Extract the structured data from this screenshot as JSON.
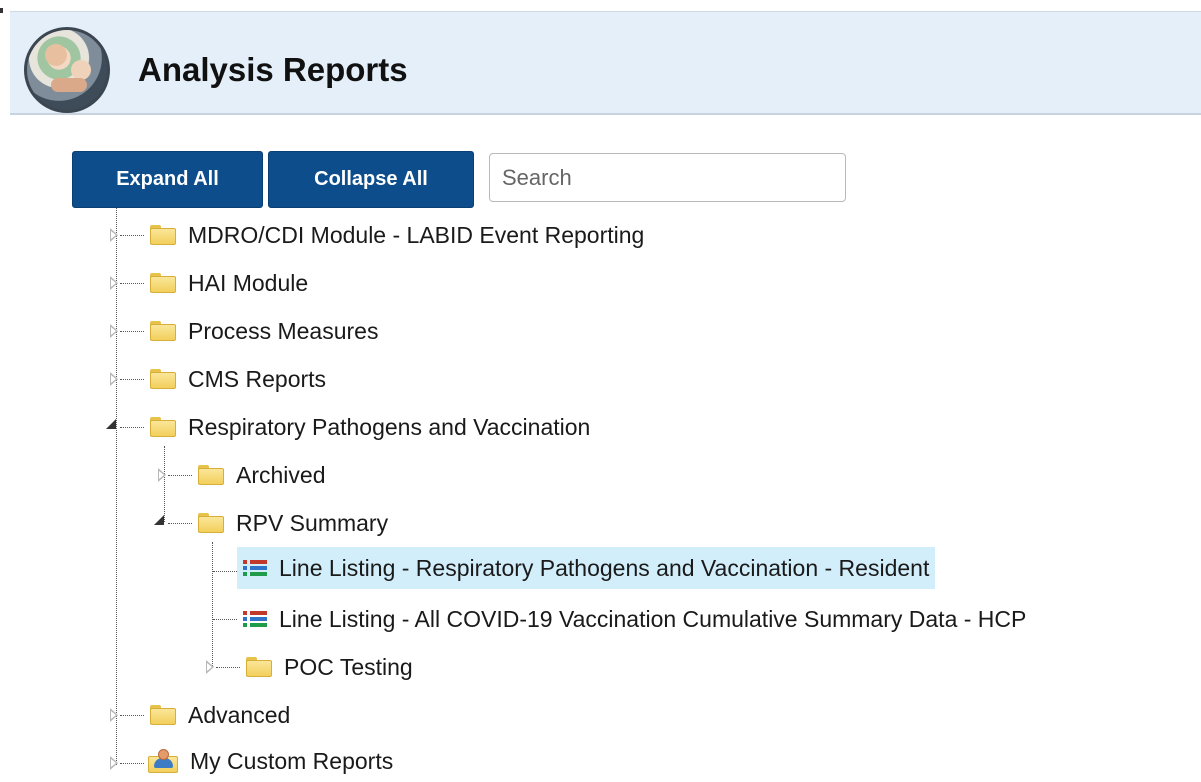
{
  "header": {
    "title": "Analysis Reports",
    "logo_icon": "caregiver-photo-logo"
  },
  "toolbar": {
    "expand_all_label": "Expand All",
    "collapse_all_label": "Collapse All",
    "search_placeholder": "Search"
  },
  "tree": {
    "items": [
      {
        "label": "MDRO/CDI Module - LABID Event Reporting",
        "icon": "folder-icon",
        "state": "collapsed"
      },
      {
        "label": "HAI Module",
        "icon": "folder-icon",
        "state": "collapsed"
      },
      {
        "label": "Process Measures",
        "icon": "folder-icon",
        "state": "collapsed"
      },
      {
        "label": "CMS Reports",
        "icon": "folder-icon",
        "state": "collapsed"
      },
      {
        "label": "Respiratory Pathogens and Vaccination",
        "icon": "folder-icon",
        "state": "expanded",
        "children": [
          {
            "label": "Archived",
            "icon": "folder-icon",
            "state": "collapsed"
          },
          {
            "label": "RPV Summary",
            "icon": "folder-icon",
            "state": "expanded",
            "children": [
              {
                "label": "Line Listing - Respiratory Pathogens and Vaccination - Resident",
                "icon": "list-report-icon",
                "selected": true
              },
              {
                "label": "Line Listing - All COVID-19 Vaccination Cumulative Summary Data - HCP",
                "icon": "list-report-icon",
                "selected": false
              },
              {
                "label": "POC Testing",
                "icon": "folder-icon",
                "state": "collapsed"
              }
            ]
          }
        ]
      },
      {
        "label": "Advanced",
        "icon": "folder-icon",
        "state": "collapsed"
      },
      {
        "label": "My Custom Reports",
        "icon": "user-folder-icon",
        "state": "collapsed"
      }
    ]
  },
  "colors": {
    "header_bg": "#e4eff9",
    "button_bg": "#0d4d8c",
    "selected_bg": "#d2eefb",
    "folder": "#f2cf5c",
    "list_icon_red": "#c0392b",
    "list_icon_blue": "#2e74c9",
    "list_icon_green": "#1e9c4a"
  }
}
